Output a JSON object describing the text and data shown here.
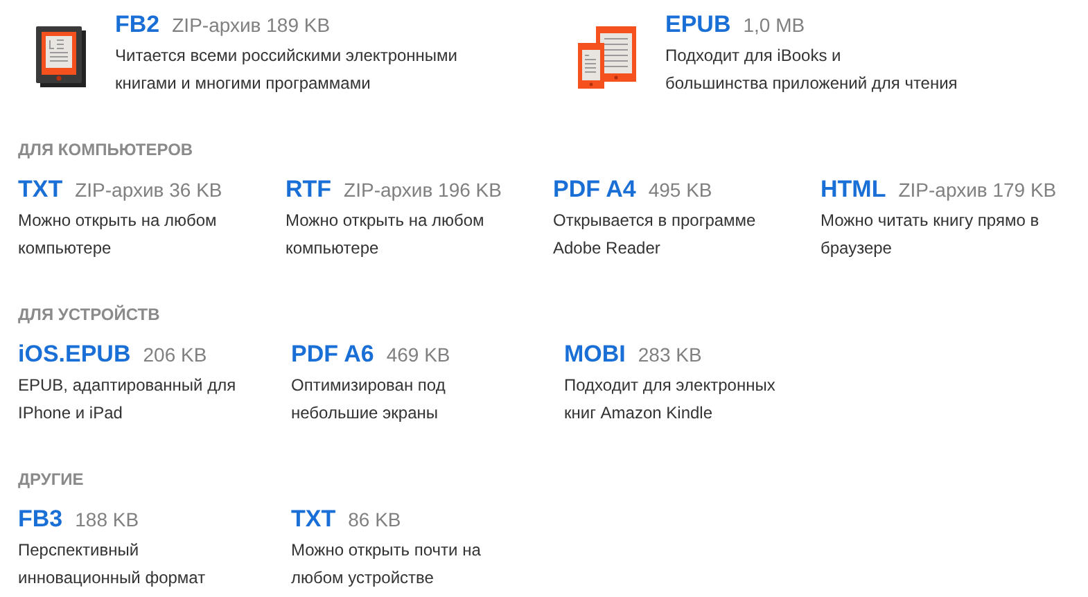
{
  "featured": [
    {
      "kind": "reader",
      "name": "FB2",
      "size": "ZIP-архив 189 KB",
      "description_lines": [
        "Читается всеми российскими электронными",
        "книгами и многими программами"
      ]
    },
    {
      "kind": "tablets",
      "name": "EPUB",
      "size": "1,0 MB",
      "description_lines": [
        "Подходит для iBooks и",
        "большинства приложений для чтения"
      ]
    }
  ],
  "sections": [
    {
      "title": "ДЛЯ КОМПЬЮТЕРОВ",
      "items": [
        {
          "name": "TXT",
          "size": "ZIP-архив 36 KB",
          "description_lines": [
            "Можно открыть на любом",
            "компьютере"
          ]
        },
        {
          "name": "RTF",
          "size": "ZIP-архив 196 KB",
          "description_lines": [
            "Можно открыть на любом",
            "компьютере"
          ]
        },
        {
          "name": "PDF A4",
          "size": "495 KB",
          "description_lines": [
            "Открывается в программе",
            "Adobe Reader"
          ]
        },
        {
          "name": "HTML",
          "size": "ZIP-архив 179 KB",
          "description_lines": [
            "Можно читать книгу прямо в",
            "браузере"
          ]
        }
      ]
    },
    {
      "title": "ДЛЯ УСТРОЙСТВ",
      "items": [
        {
          "name": "iOS.EPUB",
          "size": "206 KB",
          "description_lines": [
            "EPUB, адаптированный для",
            "IPhone и iPad"
          ]
        },
        {
          "name": "PDF A6",
          "size": "469 KB",
          "description_lines": [
            "Оптимизирован под",
            "небольшие экраны"
          ]
        },
        {
          "name": "MOBI",
          "size": "283 KB",
          "description_lines": [
            "Подходит для электронных",
            "книг Amazon Kindle"
          ]
        }
      ]
    },
    {
      "title": "ДРУГИЕ",
      "items": [
        {
          "name": "FB3",
          "size": "188 KB",
          "description_lines": [
            "Перспективный",
            "инновационный формат"
          ]
        },
        {
          "name": "TXT",
          "size": "86 KB",
          "description_lines": [
            "Можно открыть почти на",
            "любом устройстве"
          ]
        }
      ]
    }
  ]
}
